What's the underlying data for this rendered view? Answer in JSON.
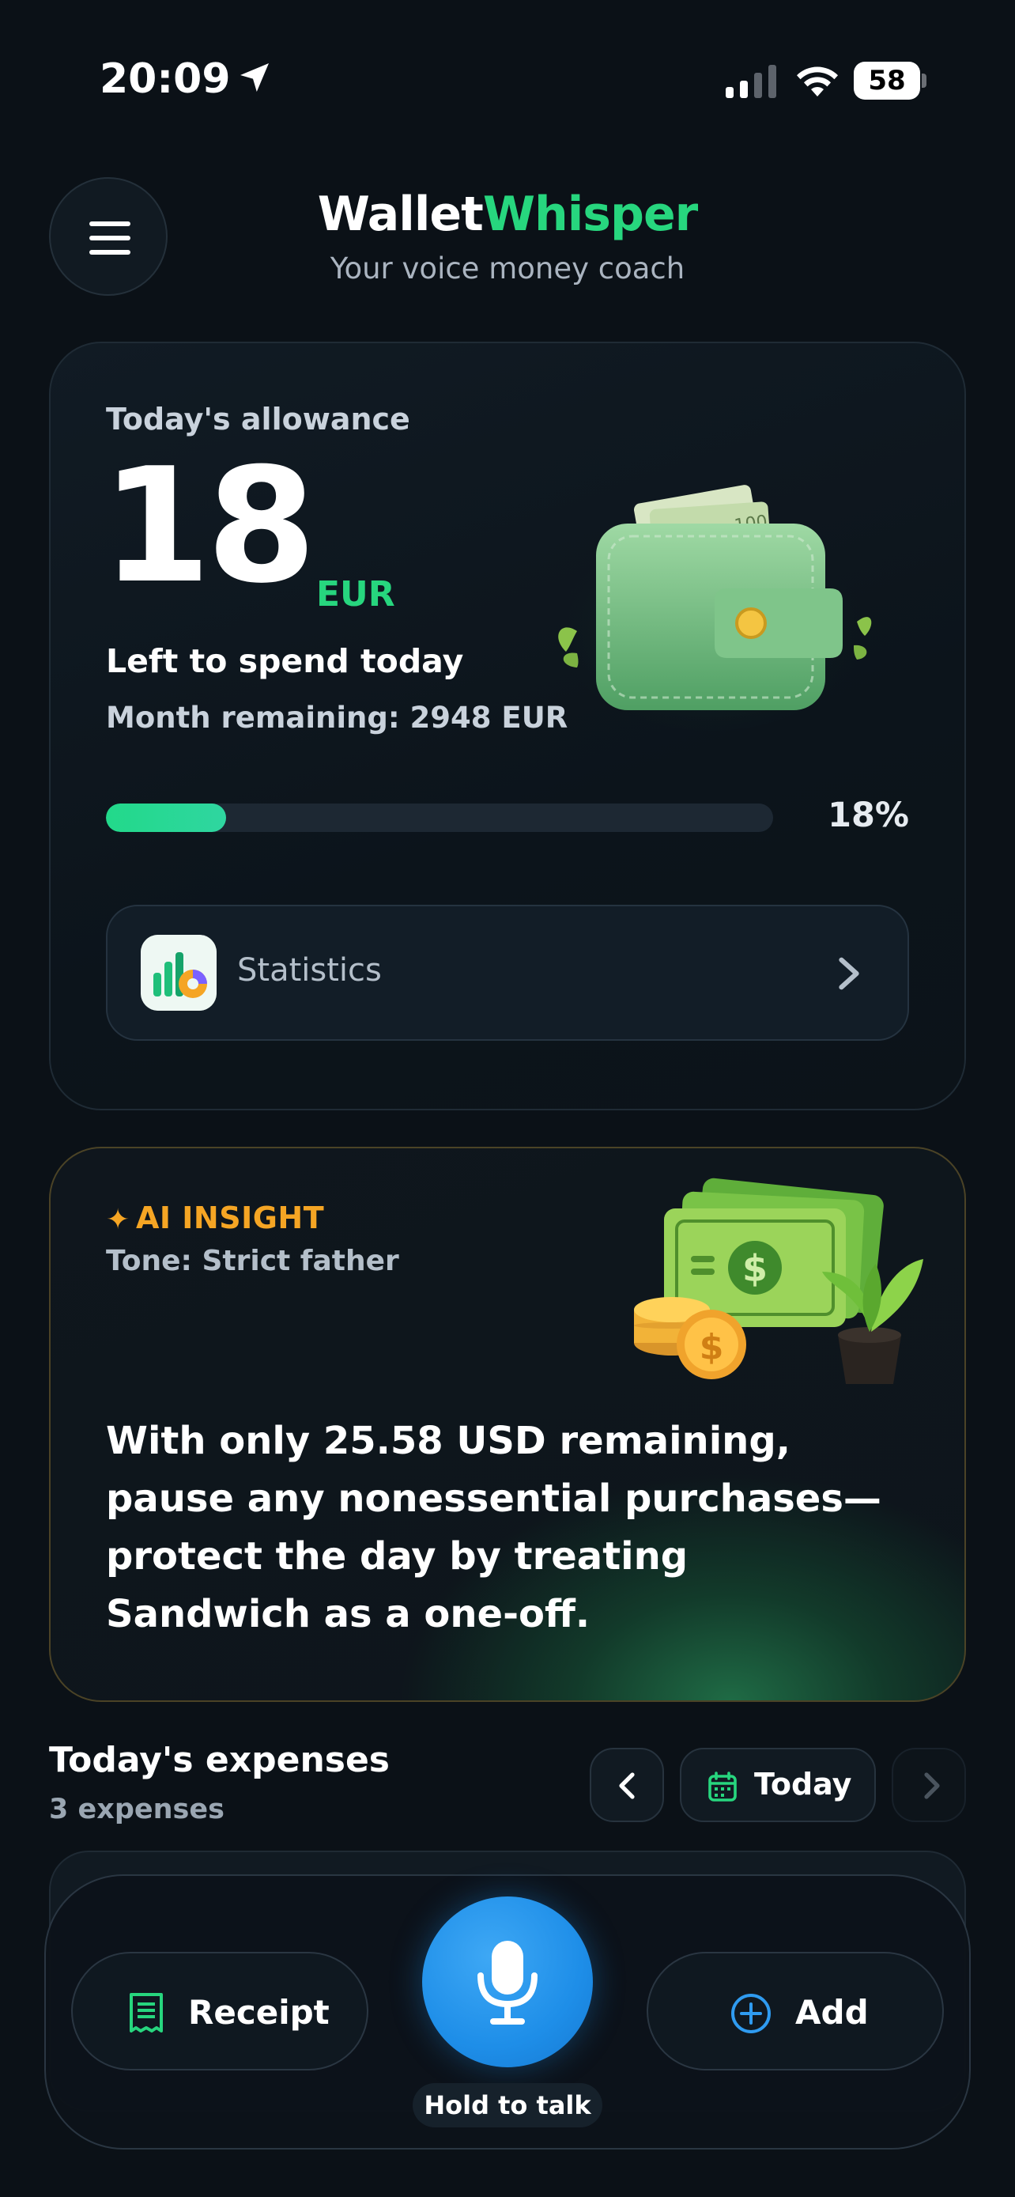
{
  "status_bar": {
    "time": "20:09",
    "battery": "58"
  },
  "header": {
    "brand_part1": "Wallet",
    "brand_part2": "Whisper",
    "tagline": "Your voice money coach"
  },
  "allowance": {
    "label": "Today's allowance",
    "amount": "18",
    "currency": "EUR",
    "subtitle": "Left to spend today",
    "month_remaining": "Month remaining: 2948 EUR",
    "progress_percent": 18,
    "progress_label": "18%",
    "statistics_label": "Statistics"
  },
  "insight": {
    "star": "✦",
    "title": "AI INSIGHT",
    "tone": "Tone: Strict father",
    "message": "With only 25.58 USD remaining, pause any nonessential purchases—protect the day by treating Sandwich as a one-off."
  },
  "expenses": {
    "title": "Today's expenses",
    "count": "3 expenses",
    "date_label": "Today"
  },
  "bottom_bar": {
    "receipt_label": "Receipt",
    "hold_label": "Hold to talk",
    "add_label": "Add"
  },
  "colors": {
    "accent_green": "#27d67e",
    "insight_orange": "#f5a524",
    "mic_blue": "#1e8ee8"
  },
  "icons": [
    "location-arrow-icon",
    "signal-icon",
    "wifi-icon",
    "battery-icon",
    "menu-icon",
    "wallet-illustration",
    "statistics-icon",
    "chevron-right-icon",
    "sparkle-icon",
    "money-plant-illustration",
    "chevron-left-icon",
    "calendar-icon",
    "receipt-icon",
    "microphone-icon",
    "plus-circle-icon"
  ]
}
